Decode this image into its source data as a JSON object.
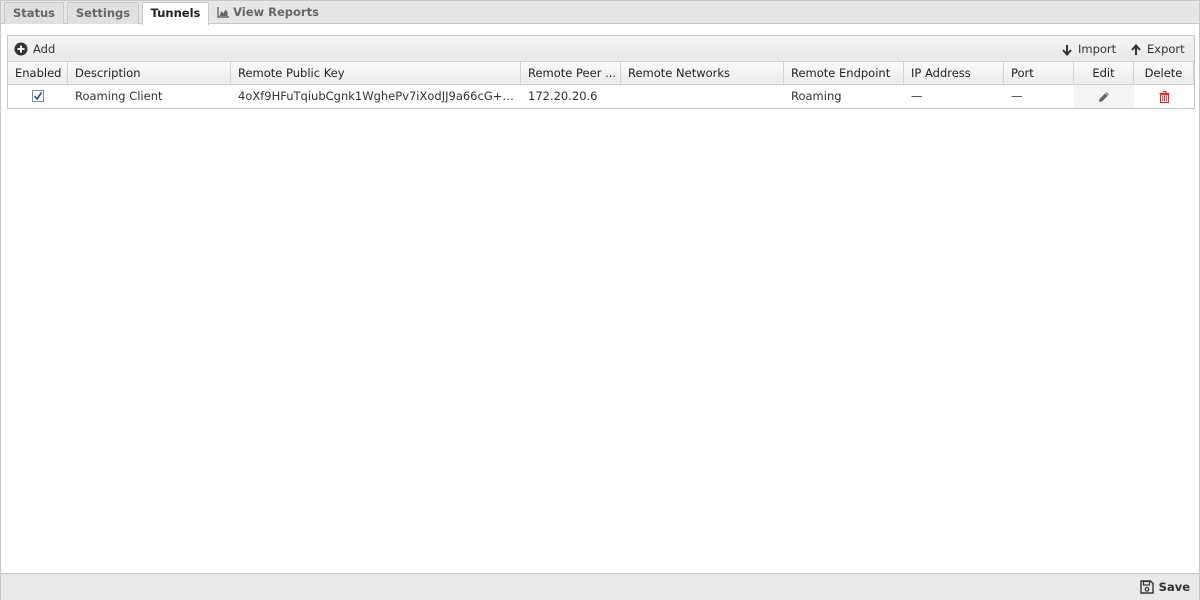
{
  "tabs": [
    {
      "label": "Status",
      "active": false
    },
    {
      "label": "Settings",
      "active": false
    },
    {
      "label": "Tunnels",
      "active": true
    },
    {
      "label": "View Reports",
      "active": false
    }
  ],
  "toolbar": {
    "add_label": "Add",
    "import_label": "Import",
    "export_label": "Export"
  },
  "table": {
    "columns": [
      "Enabled",
      "Description",
      "Remote Public Key",
      "Remote Peer ...",
      "Remote Networks",
      "Remote Endpoint",
      "IP Address",
      "Port",
      "Edit",
      "Delete"
    ],
    "rows": [
      {
        "enabled": true,
        "description": "Roaming Client",
        "remote_public_key": "4oXf9HFuTqiubCgnk1WghePv7iXodJJ9a66cG+C/...",
        "remote_peer": "172.20.20.6",
        "remote_networks": "",
        "remote_endpoint": "Roaming",
        "ip_address": "—",
        "port": "—"
      }
    ]
  },
  "footer": {
    "save_label": "Save"
  },
  "colors": {
    "delete_icon": "#e02020",
    "checkbox_check": "#2a4f9a"
  },
  "icons": {
    "add": "plus-circle-icon",
    "import": "arrow-down-icon",
    "export": "arrow-up-icon",
    "reports": "area-chart-icon",
    "edit": "pencil-icon",
    "delete": "trash-icon",
    "save": "floppy-disk-icon"
  }
}
